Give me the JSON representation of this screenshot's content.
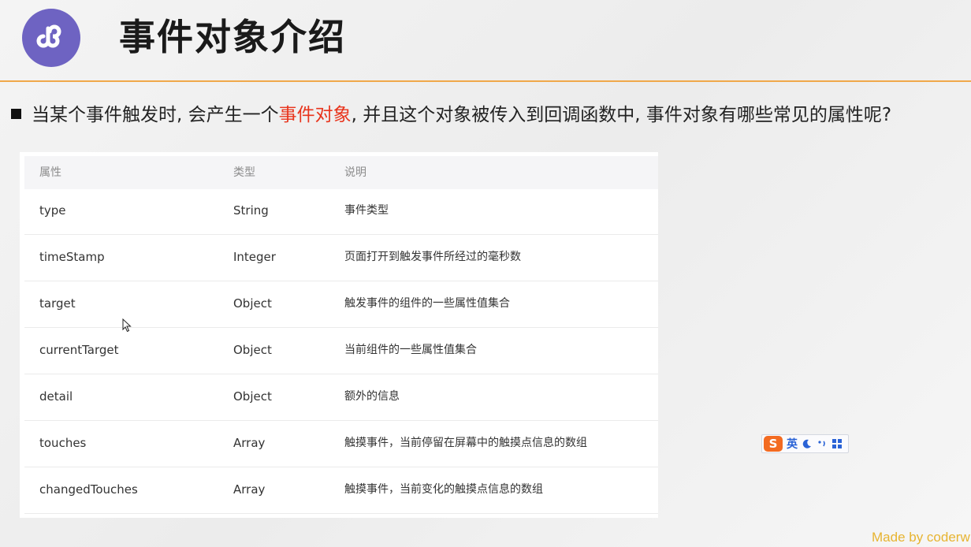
{
  "header": {
    "title": "事件对象介绍",
    "logo_icon": "mini-program-logo-icon",
    "accent_color": "#f0a84a",
    "logo_color": "#6e63c2"
  },
  "intro": {
    "before": "当某个事件触发时, 会产生一个",
    "highlight": "事件对象",
    "after": ", 并且这个对象被传入到回调函数中, 事件对象有哪些常见的属性呢?",
    "highlight_color": "#e8341c"
  },
  "table": {
    "headers": [
      "属性",
      "类型",
      "说明"
    ],
    "rows": [
      {
        "name": "type",
        "type": "String",
        "desc": "事件类型"
      },
      {
        "name": "timeStamp",
        "type": "Integer",
        "desc": "页面打开到触发事件所经过的毫秒数"
      },
      {
        "name": "target",
        "type": "Object",
        "desc": "触发事件的组件的一些属性值集合"
      },
      {
        "name": "currentTarget",
        "type": "Object",
        "desc": "当前组件的一些属性值集合"
      },
      {
        "name": "detail",
        "type": "Object",
        "desc": "额外的信息"
      },
      {
        "name": "touches",
        "type": "Array",
        "desc": "触摸事件，当前停留在屏幕中的触摸点信息的数组"
      },
      {
        "name": "changedTouches",
        "type": "Array",
        "desc": "触摸事件，当前变化的触摸点信息的数组"
      }
    ]
  },
  "ime_toolbar": {
    "logo": "S",
    "lang": "英",
    "icons": [
      "moon-icon",
      "punctuation-icon",
      "grid-menu-icon"
    ]
  },
  "footer": {
    "credit": "Made by coderw"
  }
}
